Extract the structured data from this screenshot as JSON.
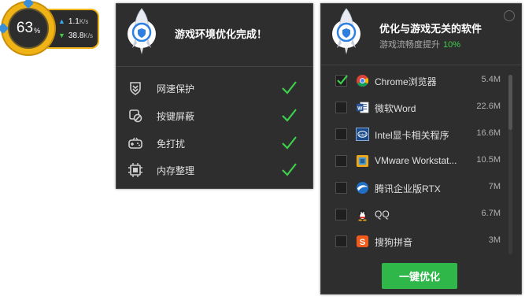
{
  "floating_ball": {
    "percent": "63",
    "percent_unit": "%",
    "upload_speed": "1.1",
    "upload_unit": "K/s",
    "download_speed": "38.8",
    "download_unit": "K/s"
  },
  "left_panel": {
    "title": "游戏环境优化完成！",
    "items": [
      {
        "label": "网速保护",
        "icon": "shield-speed-icon",
        "done": true
      },
      {
        "label": "按键屏蔽",
        "icon": "key-block-icon",
        "done": true
      },
      {
        "label": "免打扰",
        "icon": "do-not-disturb-icon",
        "done": true
      },
      {
        "label": "内存整理",
        "icon": "memory-icon",
        "done": true
      }
    ]
  },
  "right_panel": {
    "title": "优化与游戏无关的软件",
    "subtitle": "游戏流畅度提升",
    "subtitle_value": "10%",
    "software": [
      {
        "name": "Chrome浏览器",
        "size": "5.4M",
        "checked": true,
        "icon": "chrome-icon"
      },
      {
        "name": "微软Word",
        "size": "22.6M",
        "checked": false,
        "icon": "word-icon"
      },
      {
        "name": "Intel显卡相关程序",
        "size": "16.6M",
        "checked": false,
        "icon": "intel-icon"
      },
      {
        "name": "VMware Workstat...",
        "size": "10.5M",
        "checked": false,
        "icon": "vmware-icon"
      },
      {
        "name": "腾讯企业版RTX",
        "size": "7M",
        "checked": false,
        "icon": "rtx-icon"
      },
      {
        "name": "QQ",
        "size": "6.7M",
        "checked": false,
        "icon": "qq-icon"
      },
      {
        "name": "搜狗拼音",
        "size": "3M",
        "checked": false,
        "icon": "sogou-icon"
      }
    ],
    "button_label": "一键优化"
  },
  "colors": {
    "accent_green": "#2fb74a",
    "check_green": "#3ecf4c",
    "ball_gold": "#f0b316",
    "panel_bg": "#2e2e2e"
  }
}
